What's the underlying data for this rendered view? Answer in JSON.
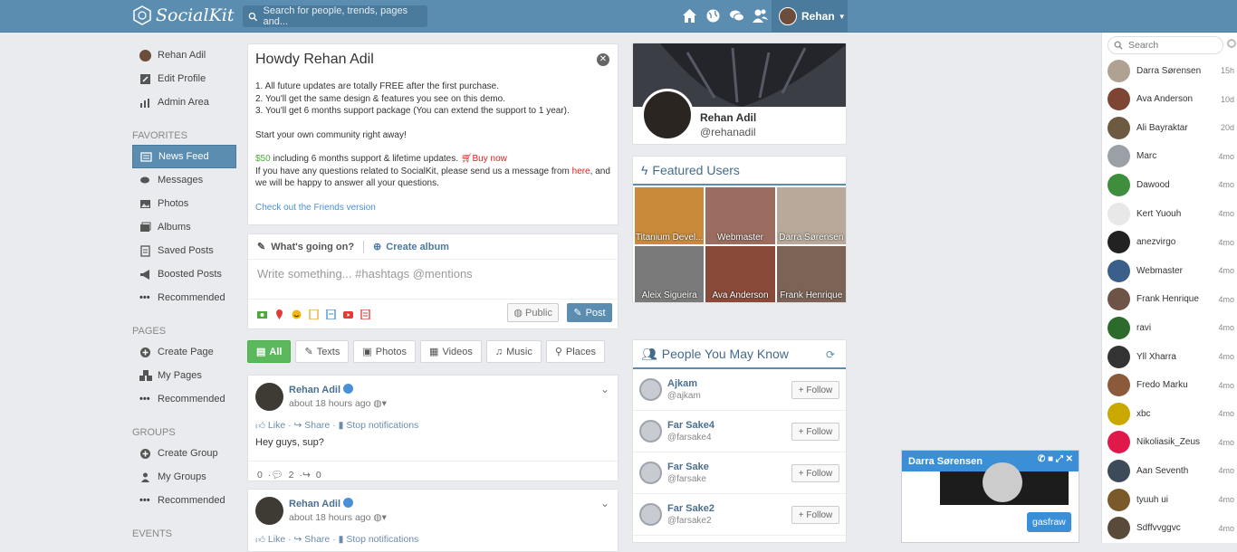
{
  "topbar": {
    "brand": "SocialKit",
    "search_placeholder": "Search for people, trends, pages and...",
    "user": "Rehan"
  },
  "leftnav": {
    "profile": [
      {
        "label": "Rehan Adil",
        "icon": "avatar"
      },
      {
        "label": "Edit Profile",
        "icon": "edit-icon"
      },
      {
        "label": "Admin Area",
        "icon": "chart-icon"
      }
    ],
    "favorites_title": "FAVORITES",
    "favorites": [
      {
        "label": "News Feed",
        "icon": "news-icon",
        "active": true
      },
      {
        "label": "Messages",
        "icon": "chat-icon"
      },
      {
        "label": "Photos",
        "icon": "image-icon"
      },
      {
        "label": "Albums",
        "icon": "album-icon"
      },
      {
        "label": "Saved Posts",
        "icon": "bookmark-icon"
      },
      {
        "label": "Boosted Posts",
        "icon": "bullhorn-icon"
      },
      {
        "label": "Recommended",
        "icon": "dots-icon"
      }
    ],
    "pages_title": "PAGES",
    "pages": [
      {
        "label": "Create Page",
        "icon": "plus-icon"
      },
      {
        "label": "My Pages",
        "icon": "cubes-icon"
      },
      {
        "label": "Recommended",
        "icon": "dots-icon"
      }
    ],
    "groups_title": "GROUPS",
    "groups": [
      {
        "label": "Create Group",
        "icon": "plus-icon"
      },
      {
        "label": "My Groups",
        "icon": "users-icon"
      },
      {
        "label": "Recommended",
        "icon": "dots-icon"
      }
    ],
    "events_title": "EVENTS"
  },
  "welcome": {
    "title": "Howdy Rehan Adil",
    "line1": "1. All future updates are totally FREE after the first purchase.",
    "line2": "2. You'll get the same design & features you see on this demo.",
    "line3": "3. You'll get 6 months support package (You can extend the support to 1 year).",
    "cta": "Start your own community right away!",
    "price": "$50",
    "price_rest": " including 6 months support & lifetime updates.",
    "buy": "Buy now",
    "q1": "If you have any questions related to SocialKit, please send us a message from ",
    "q_link": "here",
    "q2": ", and we will be happy to answer all your questions.",
    "friends": "Check out the Friends version"
  },
  "composer": {
    "tab1": "What's going on?",
    "tab2": "Create album",
    "placeholder": "Write something... #hashtags @mentions",
    "privacy": "Public",
    "post": "Post"
  },
  "filters": [
    {
      "label": "All"
    },
    {
      "label": "Texts"
    },
    {
      "label": "Photos"
    },
    {
      "label": "Videos"
    },
    {
      "label": "Music"
    },
    {
      "label": "Places"
    }
  ],
  "posts": [
    {
      "name": "Rehan Adil",
      "time": "about 18 hours ago",
      "like": "Like",
      "share": "Share",
      "notify": "Stop notifications",
      "text": "Hey guys, sup?",
      "likes": "0",
      "comments": "2",
      "shares": "0"
    },
    {
      "name": "Rehan Adil",
      "time": "about 18 hours ago",
      "like": "Like",
      "share": "Share",
      "notify": "Stop notifications"
    }
  ],
  "profile_card": {
    "name": "Rehan Adil",
    "handle": "@rehanadil"
  },
  "featured": {
    "title": "Featured Users",
    "users": [
      {
        "name": "Titanium Devel...",
        "color": "#c98a3a"
      },
      {
        "name": "Webmaster",
        "color": "#9a6d60"
      },
      {
        "name": "Darra Sørensen",
        "color": "#b8a99a"
      },
      {
        "name": "Aleix Sigueira",
        "color": "#7a7a7a"
      },
      {
        "name": "Ava Anderson",
        "color": "#8a4a3a"
      },
      {
        "name": "Frank Henrique",
        "color": "#7b6356"
      }
    ]
  },
  "pymk": {
    "title": "People You May Know",
    "follow": "Follow",
    "people": [
      {
        "name": "Ajkam",
        "handle": "@ajkam"
      },
      {
        "name": "Far Sake4",
        "handle": "@farsake4"
      },
      {
        "name": "Far Sake",
        "handle": "@farsake"
      },
      {
        "name": "Far Sake2",
        "handle": "@farsake2"
      }
    ]
  },
  "chat": {
    "search": "Search",
    "contacts": [
      {
        "name": "Darra Sørensen",
        "time": "15h",
        "color": "#b0a293"
      },
      {
        "name": "Ava Anderson",
        "time": "10d",
        "color": "#7e4434"
      },
      {
        "name": "Ali Bayraktar",
        "time": "20d",
        "color": "#6d5a40"
      },
      {
        "name": "Marc",
        "time": "4mo",
        "color": "#9aa0a6"
      },
      {
        "name": "Dawood",
        "time": "4mo",
        "color": "#3e8e3e"
      },
      {
        "name": "Kert Yuouh",
        "time": "4mo",
        "color": "#e8e8e8"
      },
      {
        "name": "anezvirgo",
        "time": "4mo",
        "color": "#222222"
      },
      {
        "name": "Webmaster",
        "time": "4mo",
        "color": "#3a5f8a"
      },
      {
        "name": "Frank Henrique",
        "time": "4mo",
        "color": "#6d5446"
      },
      {
        "name": "ravi",
        "time": "4mo",
        "color": "#2c6b2c"
      },
      {
        "name": "Yll Xharra",
        "time": "4mo",
        "color": "#333333"
      },
      {
        "name": "Fredo Marku",
        "time": "4mo",
        "color": "#8a5a3a"
      },
      {
        "name": "xbc",
        "time": "4mo",
        "color": "#c9a800"
      },
      {
        "name": "Nikoliasik_Zeus",
        "time": "4mo",
        "color": "#e0194b"
      },
      {
        "name": "Aan Seventh",
        "time": "4mo",
        "color": "#3d4a5a"
      },
      {
        "name": "tyuuh ui",
        "time": "4mo",
        "color": "#7a5a2a"
      },
      {
        "name": "Sdffvvggvc",
        "time": "4mo",
        "color": "#5a4a3a"
      }
    ]
  },
  "chatwin": {
    "name": "Darra Sørensen",
    "message": "gasfraw"
  },
  "colors": {
    "accent": "#5b8db0",
    "green": "#5cb85c",
    "chat_blue": "#3b8fd6"
  }
}
